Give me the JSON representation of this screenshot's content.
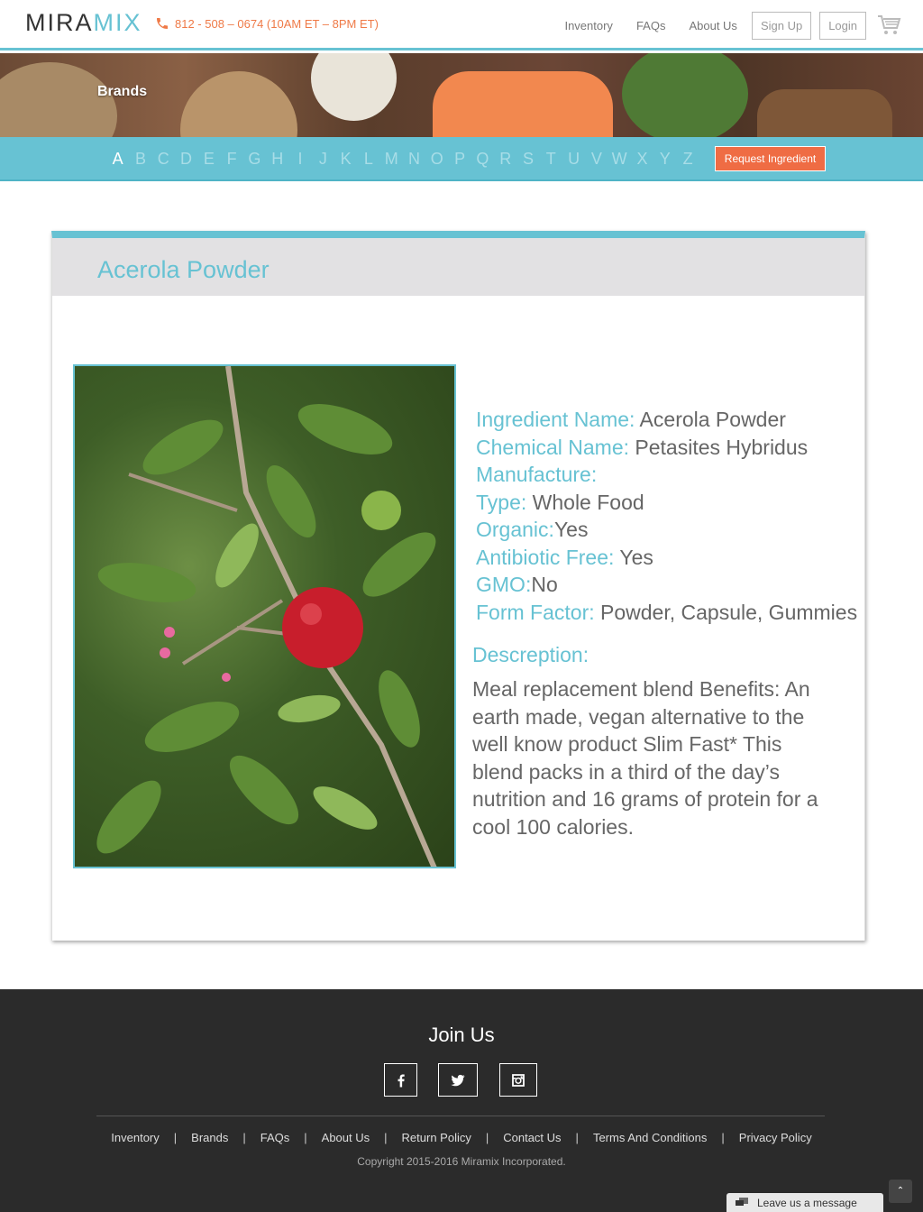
{
  "header": {
    "logo_part1": "MIRA",
    "logo_part2": "MIX",
    "phone": "812 - 508 – 0674 (10AM ET – 8PM ET)",
    "nav": [
      "Inventory",
      "FAQs",
      "About Us"
    ],
    "signup_label": "Sign Up",
    "login_label": "Login"
  },
  "banner": {
    "title": "Brands"
  },
  "alphabet": {
    "letters": [
      "A",
      "B",
      "C",
      "D",
      "E",
      "F",
      "G",
      "H",
      "I",
      "J",
      "K",
      "L",
      "M",
      "N",
      "O",
      "P",
      "Q",
      "R",
      "S",
      "T",
      "U",
      "V",
      "W",
      "X",
      "Y",
      "Z"
    ],
    "active": "A",
    "request_label": "Request Ingredient"
  },
  "product": {
    "title": "Acerola Powder",
    "fields": [
      {
        "label": "Ingredient Name:",
        "value": " Acerola Powder"
      },
      {
        "label": "Chemical Name:",
        "value": " Petasites Hybridus"
      },
      {
        "label": "Manufacture:",
        "value": ""
      },
      {
        "label": "Type:",
        "value": " Whole Food"
      },
      {
        "label": "Organic:",
        "value": "Yes"
      },
      {
        "label": "Antibiotic Free:",
        "value": " Yes"
      },
      {
        "label": "GMO:",
        "value": "No"
      },
      {
        "label": "Form Factor:",
        "value": " Powder, Capsule, Gummies"
      }
    ],
    "description_label": "Descreption:",
    "description": "Meal replacement blend Benefits: An earth made, vegan alternative to the well know product Slim Fast* This blend packs in a third of the day’s nutrition and 16 grams of protein for a cool 100 calories."
  },
  "footer": {
    "join_label": "Join Us",
    "social": [
      "facebook-icon",
      "twitter-icon",
      "instagram-icon"
    ],
    "links": [
      "Inventory",
      "Brands",
      "FAQs",
      "About Us",
      "Return Policy",
      "Contact Us",
      "Terms And Conditions",
      "Privacy Policy"
    ],
    "copyright": "Copyright 2015-2016 Miramix Incorporated.",
    "chat_label": "Leave us a message"
  },
  "colors": {
    "accent": "#67c2d3",
    "orange": "#ef7a47",
    "footer_bg": "#2b2b2b"
  }
}
